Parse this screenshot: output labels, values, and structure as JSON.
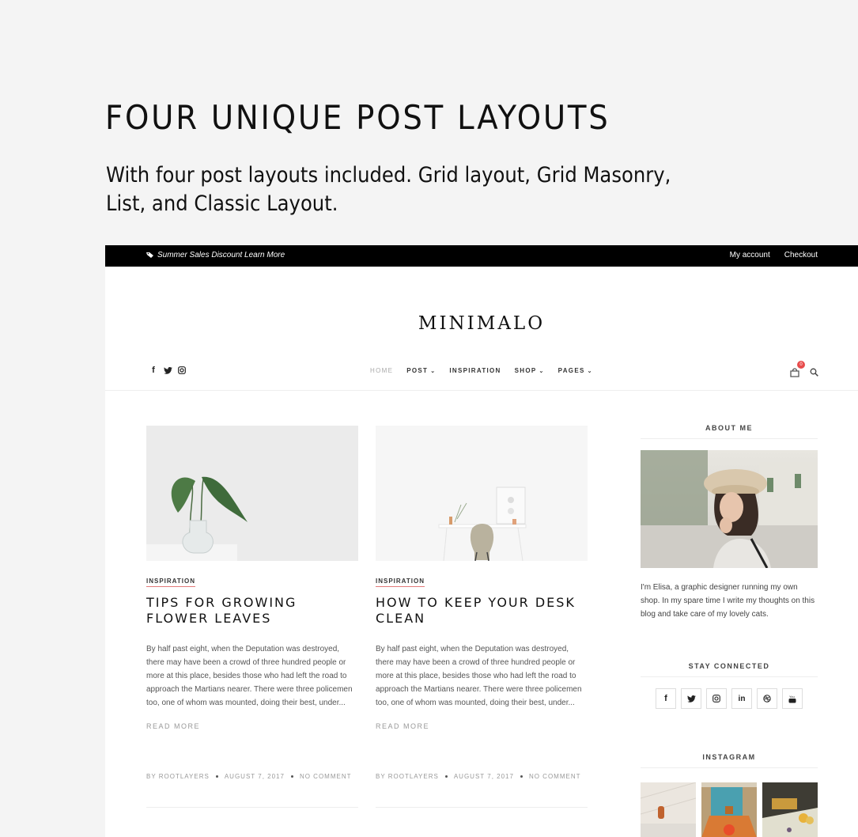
{
  "promo": {
    "title": "FOUR UNIQUE POST LAYOUTS",
    "subtitle": "With four post layouts included. Grid layout, Grid Masonry, List, and Classic Layout."
  },
  "topbar": {
    "announcement": "Summer Sales Discount Learn More",
    "announcement_icon": "tag-icon",
    "links": [
      "My account",
      "Checkout"
    ]
  },
  "site": {
    "logo": "MINIMALO",
    "social_top": [
      "facebook-icon",
      "twitter-icon",
      "instagram-icon"
    ],
    "menu": [
      {
        "label": "HOME",
        "active": true,
        "dropdown": false
      },
      {
        "label": "POST",
        "active": false,
        "dropdown": true
      },
      {
        "label": "INSPIRATION",
        "active": false,
        "dropdown": false
      },
      {
        "label": "SHOP",
        "active": false,
        "dropdown": true
      },
      {
        "label": "PAGES",
        "active": false,
        "dropdown": true
      }
    ],
    "cart_count": "0",
    "accent_color": "#e84c4c"
  },
  "posts": [
    {
      "category": "INSPIRATION",
      "title": "TIPS FOR GROWING FLOWER LEAVES",
      "excerpt": "By half past eight, when the Deputation was destroyed, there may have been a crowd of three hundred people or more at this place, besides those who had left the road to approach the Martians nearer. There were three policemen too, one of whom was mounted, doing their best, under...",
      "read_more": "READ MORE",
      "author": "BY ROOTLAYERS",
      "date": "AUGUST 7, 2017",
      "comments": "NO COMMENT",
      "image": "plant-in-vase-photo"
    },
    {
      "category": "INSPIRATION",
      "title": "HOW TO KEEP YOUR DESK CLEAN",
      "excerpt": "By half past eight, when the Deputation was destroyed, there may have been a crowd of three hundred people or more at this place, besides those who had left the road to approach the Martians nearer. There were three policemen too, one of whom was mounted, doing their best, under...",
      "read_more": "READ MORE",
      "author": "BY ROOTLAYERS",
      "date": "AUGUST 7, 2017",
      "comments": "NO COMMENT",
      "image": "desk-and-chair-photo"
    }
  ],
  "sidebar": {
    "about_title": "ABOUT ME",
    "about_text": "I'm Elisa, a graphic designer running my own shop. In my spare time I write my thoughts on this blog and take care of my lovely cats.",
    "stay_title": "STAY CONNECTED",
    "social": [
      "facebook-icon",
      "twitter-icon",
      "instagram-icon",
      "linkedin-icon",
      "dribbble-icon",
      "youtube-icon"
    ],
    "instagram_title": "INSTAGRAM"
  }
}
